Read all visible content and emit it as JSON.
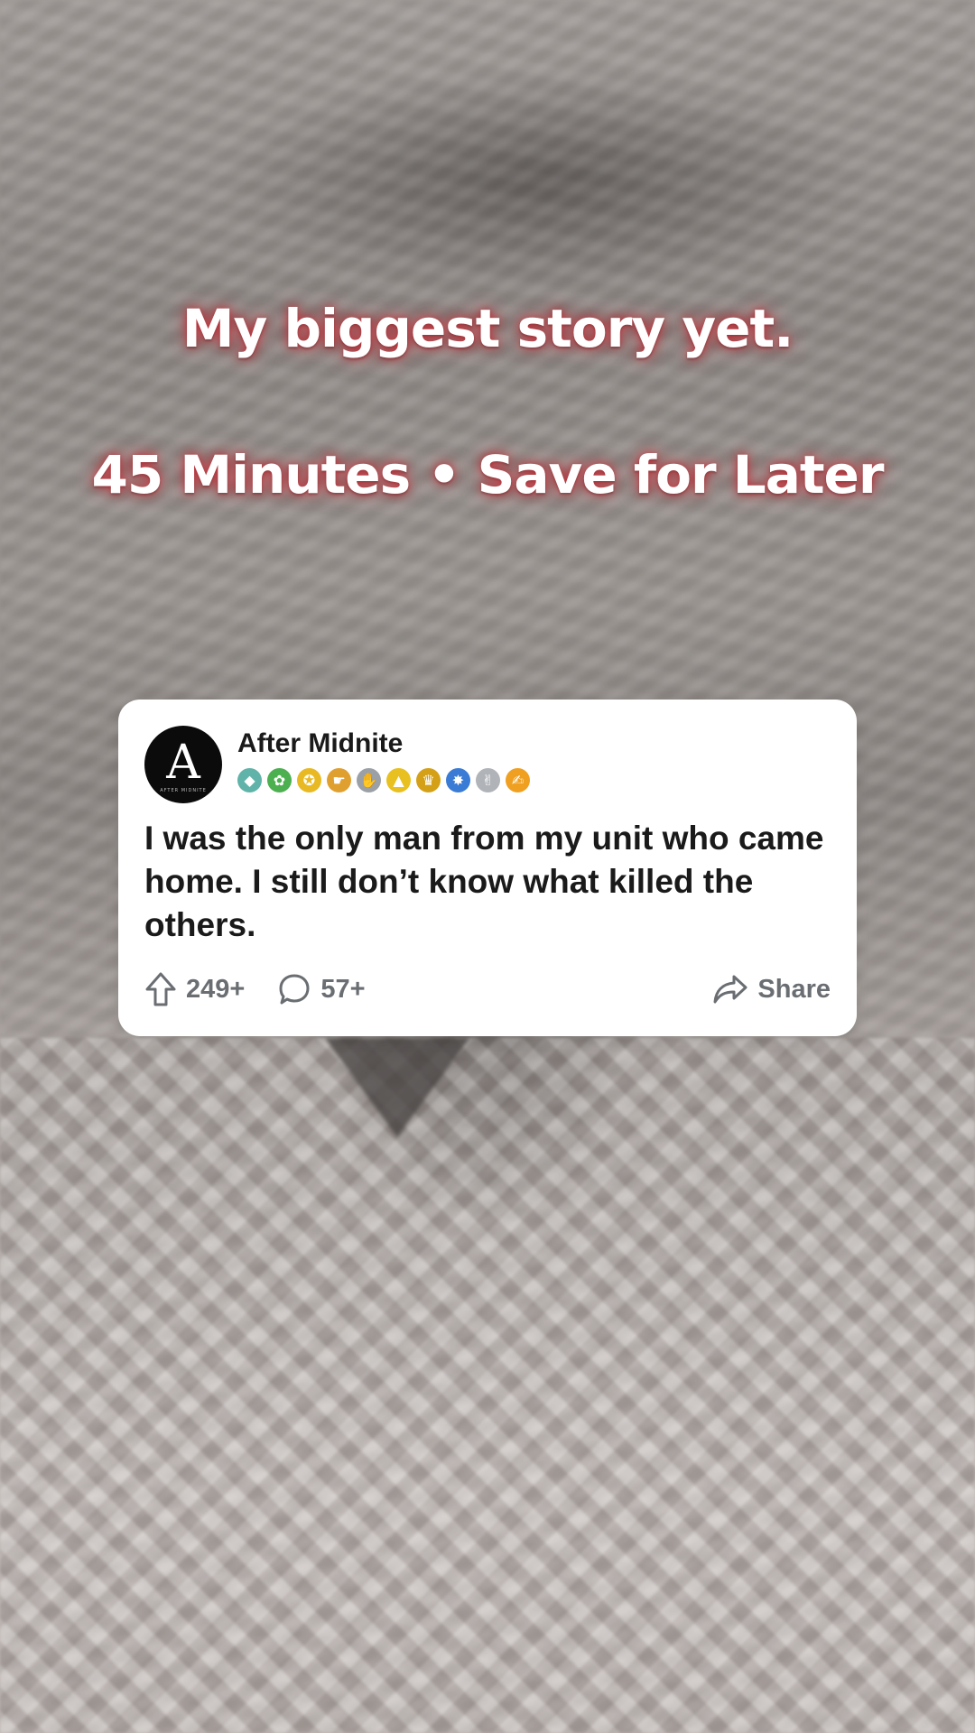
{
  "overlay": {
    "line1": "My biggest story yet.",
    "line2": "45 Minutes • Save for Later"
  },
  "post": {
    "author": "After Midnite",
    "avatar_letter": "A",
    "avatar_subtext": "AFTER MIDNITE",
    "badges": [
      {
        "icon": "gem-award-icon",
        "glyph": "◆",
        "color": "#5fb3a8"
      },
      {
        "icon": "clover-award-icon",
        "glyph": "✿",
        "color": "#4caf50"
      },
      {
        "icon": "medal-award-icon",
        "glyph": "✪",
        "color": "#e8b923"
      },
      {
        "icon": "hand-award-icon",
        "glyph": "☛",
        "color": "#e0a030"
      },
      {
        "icon": "hug-award-icon",
        "glyph": "✋",
        "color": "#9aa0a6"
      },
      {
        "icon": "arrow-award-icon",
        "glyph": "▲",
        "color": "#e8c020"
      },
      {
        "icon": "trophy-award-icon",
        "glyph": "♛",
        "color": "#d4a017"
      },
      {
        "icon": "burst-award-icon",
        "glyph": "✸",
        "color": "#3a7bd5"
      },
      {
        "icon": "clap-award-icon",
        "glyph": "✌",
        "color": "#b0b3b8"
      },
      {
        "icon": "thumbs-up-award-icon",
        "glyph": "✍",
        "color": "#f0a020"
      }
    ],
    "title": "I was the only man from my unit who came home. I still don’t know what killed the others.",
    "upvotes": "249+",
    "comments": "57+",
    "share_label": "Share"
  }
}
